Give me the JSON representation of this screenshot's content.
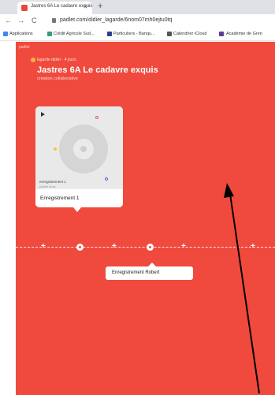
{
  "browser": {
    "tab_title": "Jastres 6A Le cadavre exquis",
    "tab_close": "×",
    "new_tab": "+",
    "back": "←",
    "forward": "→",
    "reload": "C",
    "url": "padlet.com/didier_lagarde/6nom07mh0ejtu0tq"
  },
  "bookmarks": [
    {
      "label": "Applications",
      "color": "#4285f4"
    },
    {
      "label": "Crédit Agricole Sud...",
      "color": "#3a9a7e"
    },
    {
      "label": "Particuliers - Banqu...",
      "color": "#2a3f8f"
    },
    {
      "label": "Calendrier iCloud",
      "color": "#555555"
    },
    {
      "label": "Académie de Gren",
      "color": "#5b3f95"
    }
  ],
  "padlet": {
    "brand": "padlet",
    "author": "lagarde didier · 4 jours",
    "title": "Jastres 6A Le cadavre exquis",
    "subtitle": "création collaborative",
    "background_color": "#ef4a3d"
  },
  "card": {
    "media_name": "enregistrement 1",
    "media_source": "padlet drive",
    "title": "Enregistrement 1"
  },
  "timeline": {
    "bubble_label": "Enregistrement Robert"
  }
}
